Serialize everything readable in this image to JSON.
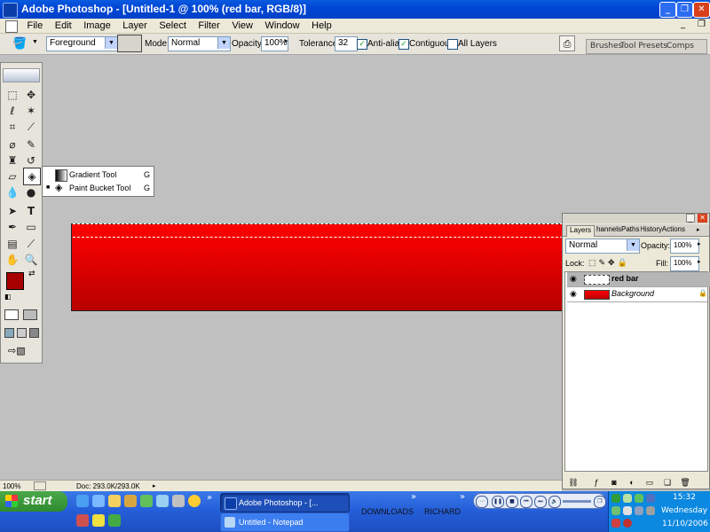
{
  "window": {
    "title": "Adobe Photoshop - [Untitled-1 @ 100% (red bar, RGB/8)]",
    "controls": [
      "_",
      "❐",
      "✕"
    ]
  },
  "menu": [
    "File",
    "Edit",
    "Image",
    "Layer",
    "Select",
    "Filter",
    "View",
    "Window",
    "Help"
  ],
  "options": {
    "fill_source": "Foreground",
    "mode_label": "Mode:",
    "mode_value": "Normal",
    "opacity_label": "Opacity:",
    "opacity_value": "100%",
    "tolerance_label": "Tolerance:",
    "tolerance_value": "32",
    "antialias_label": "Anti-alias",
    "contiguous_label": "Contiguous",
    "all_layers_label": "All Layers",
    "antialias_checked": true,
    "contiguous_checked": true,
    "all_layers_checked": false
  },
  "palette_well": [
    "Brushes",
    "Tool Presets",
    "Comps"
  ],
  "tool_flyout": {
    "items": [
      {
        "label": "Gradient Tool",
        "key": "G",
        "selected": false
      },
      {
        "label": "Paint Bucket Tool",
        "key": "G",
        "selected": true
      }
    ]
  },
  "colors": {
    "foreground": "#a80000",
    "background": "#ff0000",
    "bar_top": "#ff0000",
    "bar_bottom": "#b80000"
  },
  "layers_palette": {
    "tabs": [
      "Layers",
      "Channels",
      "Paths",
      "History",
      "Actions"
    ],
    "blend_mode": "Normal",
    "opacity_label": "Opacity:",
    "opacity_value": "100%",
    "lock_label": "Lock:",
    "fill_label": "Fill:",
    "fill_value": "100%",
    "layers": [
      {
        "name": "red bar",
        "active": true,
        "locked": false
      },
      {
        "name": "Background",
        "active": false,
        "locked": true
      }
    ]
  },
  "status": {
    "zoom": "100%",
    "doc": "Doc: 293.0K/293.0K"
  },
  "taskbar": {
    "start_label": "start",
    "tasks": [
      "Adobe Photoshop - [...",
      "Untitled - Notepad"
    ],
    "toolbars": [
      "DOWNLOADS",
      "RICHARD"
    ],
    "clock_time": "15:32",
    "clock_day": "Wednesday",
    "clock_date": "11/10/2006"
  }
}
